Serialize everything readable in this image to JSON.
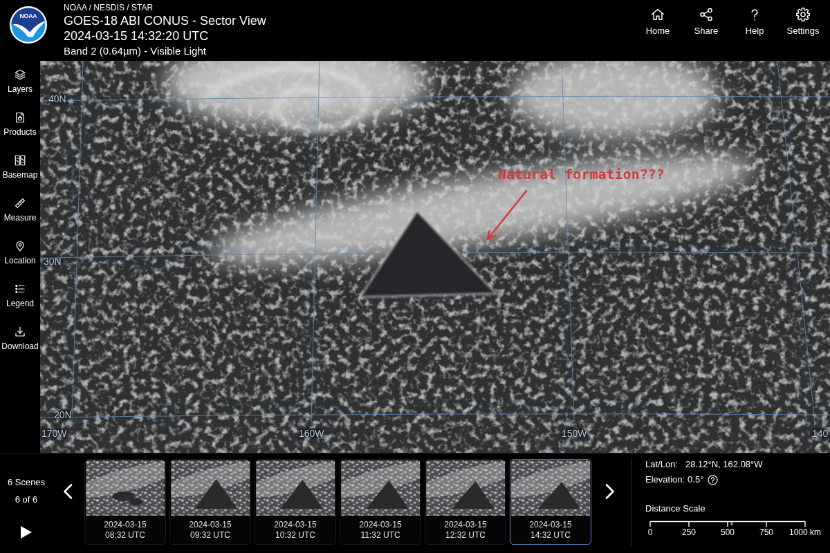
{
  "header": {
    "logo_text": "NOAA",
    "organization": "NOAA / NESDIS / STAR",
    "title": "GOES-18 ABI CONUS - Sector View",
    "timestamp": "2024-03-15 14:32:20 UTC",
    "band": "Band 2 (0.64µm) - Visible Light"
  },
  "nav": [
    {
      "kind": "home",
      "label": "Home"
    },
    {
      "kind": "share",
      "label": "Share"
    },
    {
      "kind": "help",
      "label": "Help"
    },
    {
      "kind": "settings",
      "label": "Settings"
    }
  ],
  "sidebar": {
    "items": [
      {
        "kind": "layers",
        "label": "Layers"
      },
      {
        "kind": "products",
        "label": "Products"
      },
      {
        "kind": "basemap",
        "label": "Basemap"
      },
      {
        "kind": "measure",
        "label": "Measure"
      },
      {
        "kind": "location",
        "label": "Location"
      },
      {
        "kind": "legend",
        "label": "Legend"
      },
      {
        "kind": "download",
        "label": "Download"
      }
    ]
  },
  "map": {
    "latitude_labels": [
      "40N",
      "30N",
      "20N"
    ],
    "longitude_labels": [
      "170W",
      "160W",
      "150W",
      "140"
    ],
    "annotation": "Natural formation???"
  },
  "timeline": {
    "scene_count": "6 Scenes",
    "position": "6 of 6",
    "scenes": [
      {
        "date": "2024-03-15",
        "time": "08:32 UTC",
        "selected": false
      },
      {
        "date": "2024-03-15",
        "time": "09:32 UTC",
        "selected": false
      },
      {
        "date": "2024-03-15",
        "time": "10:32 UTC",
        "selected": false
      },
      {
        "date": "2024-03-15",
        "time": "11:32 UTC",
        "selected": false
      },
      {
        "date": "2024-03-15",
        "time": "12:32 UTC",
        "selected": false
      },
      {
        "date": "2024-03-15",
        "time": "14:32 UTC",
        "selected": true
      }
    ]
  },
  "info": {
    "latlon_label": "Lat/Lon:",
    "latlon_value": "28.12°N, 162.08°W",
    "elevation_label": "Elevation:",
    "elevation_value": "0.5°",
    "scale_title": "Distance Scale",
    "scale_ticks": [
      "0",
      "250",
      "500",
      "750",
      "1000 km"
    ]
  }
}
